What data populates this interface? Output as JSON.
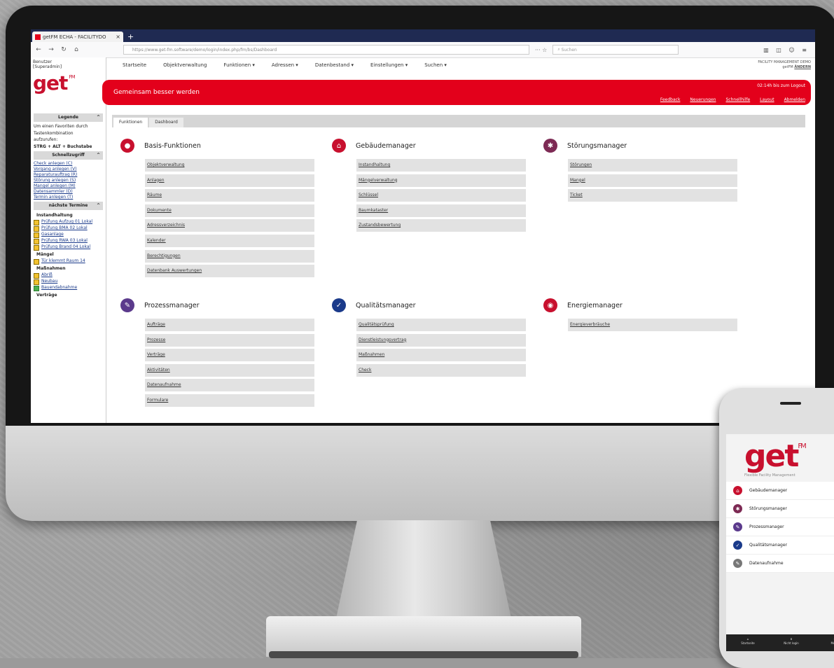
{
  "colors": {
    "brand_red": "#e3001b",
    "dark_blue": "#1f2a52",
    "basis": "#c8102e",
    "gebaeude": "#c8102e",
    "stoerung": "#7d2a54",
    "prozess": "#5b3a8c",
    "qualitaet": "#1a3a8a",
    "energie": "#c8102e",
    "datenaufnahme": "#777777"
  },
  "browser": {
    "tab_title": "getFM ECHA - FACILITYDO",
    "url": "https://www.get-fm.software/demo/login/index.php/fm/bs/Dashboard",
    "search_placeholder": "Suchen",
    "new_tab": "+"
  },
  "user": {
    "line1": "Benutzer",
    "line2": "[Superadmin]"
  },
  "tenant": {
    "line1": "FACILITY MANAGEMENT DEMO",
    "line2": "getFM",
    "line3": "ÄNDERN"
  },
  "menu": [
    "Startseite",
    "Objektverwaltung",
    "Funktionen ▾",
    "Adressen ▾",
    "Datenbestand ▾",
    "Einstellungen ▾",
    "Suchen ▾"
  ],
  "banner": {
    "title": "Gemeinsam besser werden",
    "time": "02:14h bis zum Logout",
    "links": [
      "Feedback",
      "Neuerungen",
      "Schnellhilfe",
      "Layout",
      "Abmelden"
    ]
  },
  "sidebar": {
    "legend_title": "Legende",
    "legend_text": [
      "Um einen Favoriten durch",
      "Tastenkombination",
      "aufzurufen:",
      "STRG + ALT + Buchstabe"
    ],
    "quick_title": "Schnellzugriff",
    "quick_links": [
      "Check anlegen (C)",
      "Vorgang anlegen (V)",
      "Reparaturauftrag (R)",
      "Störung anlegen (S)",
      "Mangel anlegen (M)",
      "Datensammler (D)",
      "Termin anlegen (T)"
    ],
    "due_title": "nächste Termine",
    "groups": [
      {
        "label": "Instandhaltung",
        "items": [
          {
            "text": "Prüfung Aufzug 01 Lokal",
            "color": "yellow"
          },
          {
            "text": "Prüfung BMA 02 Lokal",
            "color": "yellow"
          },
          {
            "text": "Gasanlage",
            "color": "yellow"
          },
          {
            "text": "Prüfung RWA 03 Lokal",
            "color": "yellow"
          },
          {
            "text": "Prüfung Brand 04 Lokal",
            "color": "yellow"
          }
        ]
      },
      {
        "label": "Mängel",
        "items": [
          {
            "text": "Tür klemmt Raum 14",
            "color": "yellow"
          }
        ]
      },
      {
        "label": "Maßnahmen",
        "items": [
          {
            "text": "Abriß",
            "color": "yellow"
          },
          {
            "text": "Neubau",
            "color": "yellow"
          },
          {
            "text": "Bauendabnahme",
            "color": "green"
          }
        ]
      },
      {
        "label": "Verträge",
        "items": []
      }
    ]
  },
  "app_tabs": [
    "Funktionen",
    "Dashboard"
  ],
  "modules": [
    {
      "title": "Basis-Funktionen",
      "icon": "record-icon",
      "glyph": "●",
      "color": "#c8102e",
      "items": [
        "Objektverwaltung",
        "Anlagen",
        "Räume",
        "Dokumente",
        "Adressverzeichnis",
        "Kalender",
        "Berechtigungen",
        "Datenbank Auswertungen"
      ]
    },
    {
      "title": "Gebäudemanager",
      "icon": "house-icon",
      "glyph": "⌂",
      "color": "#c8102e",
      "items": [
        "Instandhaltung",
        "Mängelverwaltung",
        "Schlüssel",
        "Baumkataster",
        "Zustandsbewertung"
      ]
    },
    {
      "title": "Störungsmanager",
      "icon": "gear-icon",
      "glyph": "✱",
      "color": "#7d2a54",
      "items": [
        "Störungen",
        "Mangel",
        "Ticket"
      ]
    },
    {
      "title": "Prozessmanager",
      "icon": "pencil-icon",
      "glyph": "✎",
      "color": "#5b3a8c",
      "items": [
        "Aufträge",
        "Prozesse",
        "Verträge",
        "Aktivitäten",
        "Datenaufnahme",
        "Formulare"
      ]
    },
    {
      "title": "Qualitätsmanager",
      "icon": "check-icon",
      "glyph": "✓",
      "color": "#1a3a8a",
      "items": [
        "Qualitätsprüfung",
        "Dienstleistungsvertrag",
        "Maßnahmen",
        "Check"
      ]
    },
    {
      "title": "Energiemanager",
      "icon": "bulb-icon",
      "glyph": "◉",
      "color": "#c8102e",
      "items": [
        "Energieverbräuche"
      ]
    }
  ],
  "phone": {
    "subtitle": "Flexible Facility Management",
    "items": [
      {
        "label": "Gebäudemanager",
        "icon": "house-icon",
        "glyph": "⌂",
        "color": "#c8102e"
      },
      {
        "label": "Störungsmanager",
        "icon": "gear-icon",
        "glyph": "✱",
        "color": "#7d2a54"
      },
      {
        "label": "Prozessmanager",
        "icon": "pencil-icon",
        "glyph": "✎",
        "color": "#5b3a8c"
      },
      {
        "label": "Qualitätsmanager",
        "icon": "check-icon",
        "glyph": "✓",
        "color": "#1a3a8a"
      },
      {
        "label": "Datenaufnahme",
        "icon": "pencil-icon",
        "glyph": "✎",
        "color": "#777777"
      }
    ],
    "bottom": [
      "Startseite",
      "Nicht login",
      "Menü"
    ]
  },
  "logo": {
    "main": "get",
    "sup": "FM"
  }
}
